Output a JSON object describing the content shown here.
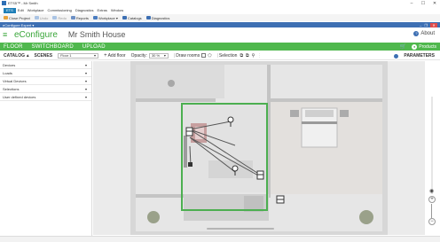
{
  "window": {
    "title": "ETS5™ - Mr Smith",
    "controls": {
      "minimize": "–",
      "maximize": "☐",
      "close": "✕"
    }
  },
  "menu": {
    "ets_label": "ETS",
    "items": [
      "Edit",
      "Workplace",
      "Commissioning",
      "Diagnostics",
      "Extras",
      "Window"
    ]
  },
  "toolbar": {
    "items": [
      "Close Project",
      "Undo",
      "Redo",
      "Reports",
      "Workplace ▾",
      "Catalogs",
      "Diagnostics"
    ]
  },
  "panel": {
    "title": "eConfigure Expert ▾",
    "controls": {
      "minimize": "–",
      "restore": "❐",
      "close": "✕"
    }
  },
  "header": {
    "menu_glyph": "≡",
    "brand": "eConfigure",
    "project": "Mr Smith House",
    "about": "About"
  },
  "nav": {
    "tabs": [
      "FLOOR",
      "SWITCHBOARD",
      "UPLOAD"
    ],
    "products": "Products"
  },
  "filter": {
    "catalog": "CATALOG",
    "catalog_arrow": "▴",
    "scenes": "SCENES",
    "floor_value": "Floor 1",
    "add_floor": "Add floor",
    "opacity_label": "Opacity:",
    "opacity_value": "30 %",
    "draw_rooms": "Draw rooms",
    "selection": "Selection",
    "parameters": "PARAMETERS"
  },
  "sidebar": {
    "items": [
      {
        "label": "Devices"
      },
      {
        "label": "Loads"
      },
      {
        "label": "Virtual Devices"
      },
      {
        "label": "Selections"
      },
      {
        "label": "User defined devices"
      }
    ]
  },
  "colors": {
    "green": "#4fb84d",
    "blue": "#3d6fb3",
    "room_outline": "#4caf50",
    "close_red": "#e04b4b"
  }
}
